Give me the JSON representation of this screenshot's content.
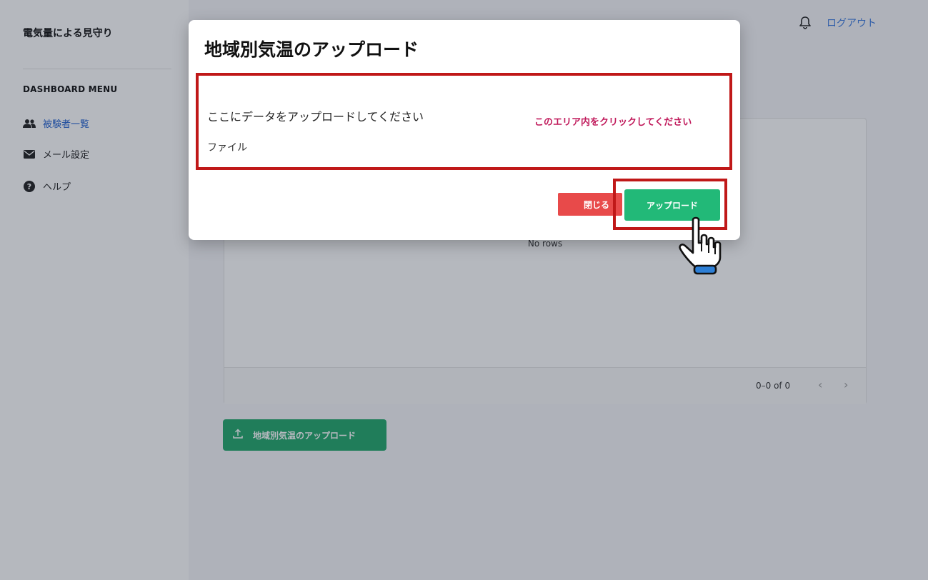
{
  "app": {
    "title": "電気量による見守り"
  },
  "sidebar": {
    "menu_heading": "DASHBOARD MENU",
    "items": [
      {
        "label": "被験者一覧",
        "icon": "users-icon",
        "active": true
      },
      {
        "label": "メール設定",
        "icon": "envelope-icon",
        "active": false
      },
      {
        "label": "ヘルプ",
        "icon": "question-circle-icon",
        "active": false
      }
    ]
  },
  "header": {
    "logout_label": "ログアウト",
    "bell_icon": "bell-icon"
  },
  "grid": {
    "empty_text": "No rows",
    "pagination_text": "0–0 of 0",
    "prev_icon": "chevron-left-icon",
    "next_icon": "chevron-right-icon"
  },
  "main": {
    "upload_button_label": "地域別気温のアップロード"
  },
  "modal": {
    "title": "地域別気温のアップロード",
    "dropzone_text": "ここにデータをアップロードしてください",
    "dropzone_sub": "ファイル",
    "hint": "このエリア内をクリックしてください",
    "close_label": "閉じる",
    "upload_label": "アップロード"
  },
  "colors": {
    "accent_green": "#22b978",
    "close_red": "#e84a4a",
    "highlight_red": "#c01818",
    "hint_magenta": "#c0185a",
    "link_blue": "#3d7be0"
  }
}
